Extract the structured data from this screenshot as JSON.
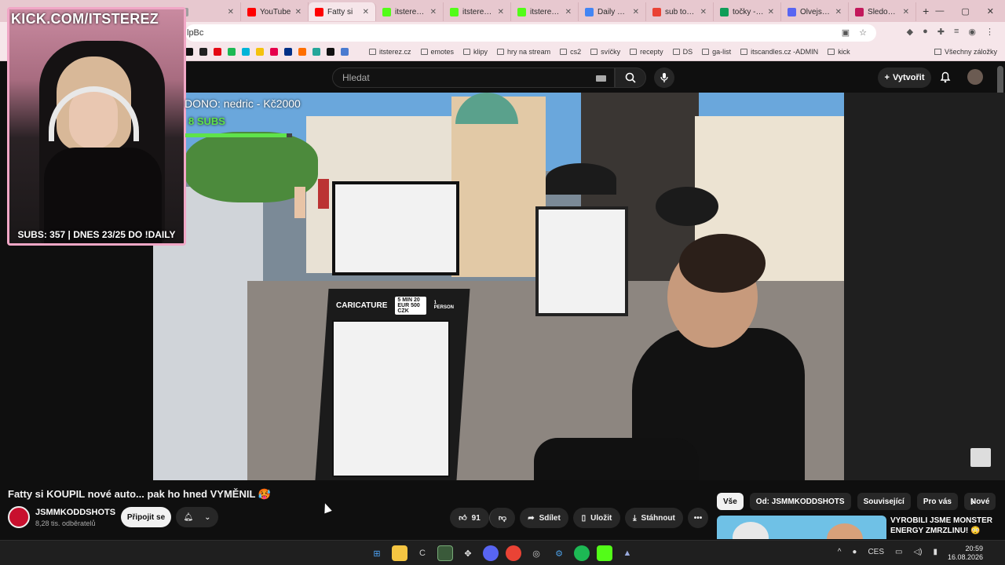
{
  "browser": {
    "tabs": [
      {
        "title": "",
        "color": "#9e9e9e"
      },
      {
        "title": "YouTube",
        "color": "#ff0000"
      },
      {
        "title": "Fatty si",
        "color": "#ff0000",
        "active": true
      },
      {
        "title": "itsterez - V",
        "color": "#53fc18"
      },
      {
        "title": "itsterez - V",
        "color": "#53fc18"
      },
      {
        "title": "itsterez - V",
        "color": "#53fc18"
      },
      {
        "title": "Daily quest",
        "color": "#4285f4"
      },
      {
        "title": "sub točka",
        "color": "#ea4335"
      },
      {
        "title": "točky - Tab",
        "color": "#0f9d58"
      },
      {
        "title": "Olvejs vet",
        "color": "#5865f2"
      },
      {
        "title": "Sledování",
        "color": "#c2185b"
      }
    ],
    "new_tab": "+",
    "address_fragment": "lpBc",
    "bookmarks": [
      "itsterez.cz",
      "emotes",
      "klipy",
      "hry na stream",
      "cs2",
      "svíčky",
      "recepty",
      "DS",
      "ga-list",
      "itscandles.cz -ADMIN",
      "kick"
    ],
    "all_bookmarks": "Všechny záložky"
  },
  "overlay": {
    "brand": "KICK.COM/ITSTEREZ",
    "subs_line": "SUBS: 357 | DNES 23/25 DO !DAILY",
    "dono": "DONO: nedric - Kč2000",
    "sub_goal": "8 SUBS",
    "goal_progress": 0.95
  },
  "youtube": {
    "search_placeholder": "Hledat",
    "create_label": "Vytvořit",
    "video_title": "Fatty si KOUPIL nové auto... pak ho hned VYMĚNIL 🥵",
    "channel_name": "JSMMKODDSHOTS",
    "channel_subs": "8,28 tis. odběratelů",
    "join_label": "Připojit se",
    "likes": "91",
    "share_label": "Sdílet",
    "save_label": "Uložit",
    "download_label": "Stáhnout",
    "more_label": "•••",
    "chips": [
      "Vše",
      "Od: JSMMKODDSHOTS",
      "Související",
      "Pro vás",
      "Nové"
    ],
    "rec_title": "VYROBILI JSME MONSTER ENERGY ZMRZLINU! 😳"
  },
  "video_scene": {
    "sign_text": "CARICATURE",
    "sign_price": "5 MIN 20 EUR 500 CZK",
    "sign_person": "1 PERSON"
  },
  "taskbar": {
    "lang": "CES",
    "time": "20:59",
    "date": "16.08.2026"
  }
}
